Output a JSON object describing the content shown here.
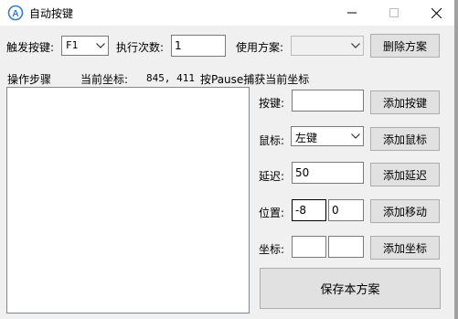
{
  "window": {
    "title": "自动按键",
    "icon": "app-logo-icon"
  },
  "toolbar": {
    "trigger_label": "触发按键:",
    "trigger_value": "F1",
    "times_label": "执行次数:",
    "times_value": "1",
    "scheme_label": "使用方案:",
    "scheme_value": "",
    "delete_scheme_button": "删除方案"
  },
  "steps": {
    "label": "操作步骤",
    "coord_label": "当前坐标:",
    "coord_value": "845, 411",
    "hint": "按Pause捕获当前坐标",
    "items": []
  },
  "panel": {
    "key_label": "按键:",
    "key_value": "",
    "add_key_button": "添加按键",
    "mouse_label": "鼠标:",
    "mouse_value": "左键",
    "add_mouse_button": "添加鼠标",
    "delay_label": "延迟:",
    "delay_value": "50",
    "add_delay_button": "添加延迟",
    "move_label": "位置:",
    "move_x": "-8",
    "move_y": "0",
    "add_move_button": "添加移动",
    "coord_label": "坐标:",
    "coord_x": "",
    "coord_y": "",
    "add_coord_button": "添加坐标",
    "save_button": "保存本方案"
  }
}
